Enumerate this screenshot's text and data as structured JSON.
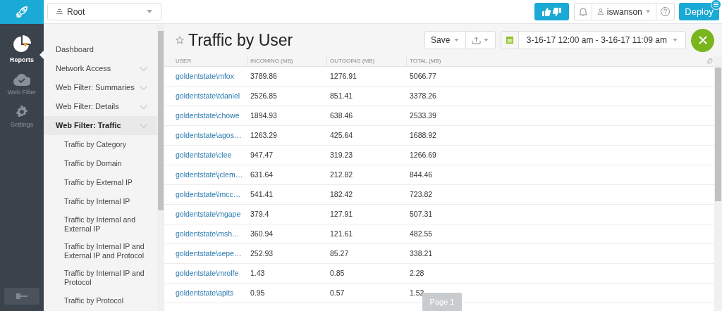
{
  "app_rail": {
    "items": [
      {
        "label": "Reports",
        "kind": "reports",
        "selected": true
      },
      {
        "label": "Web Filter",
        "kind": "webfilter",
        "selected": false
      },
      {
        "label": "Settings",
        "kind": "settings",
        "selected": false
      }
    ]
  },
  "scope_selector": {
    "value": "Root"
  },
  "top_bar": {
    "user": "iswanson",
    "deploy_button": "Deploy"
  },
  "nav": {
    "items": [
      {
        "label": "Dashboard",
        "kind": "link",
        "selected": false
      },
      {
        "label": "Network Access",
        "kind": "group",
        "selected": false
      },
      {
        "label": "Web Filter: Summaries",
        "kind": "group",
        "selected": false
      },
      {
        "label": "Web Filter: Details",
        "kind": "group",
        "selected": false
      },
      {
        "label": "Web Filter: Traffic",
        "kind": "group",
        "selected": true,
        "children": [
          {
            "label": "Traffic by Category"
          },
          {
            "label": "Traffic by Domain"
          },
          {
            "label": "Traffic by External IP"
          },
          {
            "label": "Traffic by Internal IP"
          },
          {
            "label": "Traffic by Internal and External IP"
          },
          {
            "label": "Traffic by Internal IP and External IP and Protocol"
          },
          {
            "label": "Traffic by Internal IP and Protocol"
          },
          {
            "label": "Traffic by Protocol"
          }
        ]
      }
    ]
  },
  "report": {
    "title": "Traffic by User",
    "starred": false,
    "save_button": "Save",
    "date_range": "3-16-17 12:00 am - 3-16-17 11:09 am"
  },
  "table": {
    "columns": [
      "USER",
      "INCOMING (MB)",
      "OUTGOING (MB)",
      "TOTAL (MB)"
    ],
    "rows": [
      [
        "goldentstate\\mfox",
        "3789.86",
        "1276.91",
        "5066.77"
      ],
      [
        "goldentstate\\tdaniel",
        "2526.85",
        "851.41",
        "3378.26"
      ],
      [
        "goldentstate\\chowe",
        "1894.93",
        "638.46",
        "2533.39"
      ],
      [
        "goldentstate\\agos…",
        "1263.29",
        "425.64",
        "1688.92"
      ],
      [
        "goldentstate\\clee",
        "947.47",
        "319.23",
        "1266.69"
      ],
      [
        "goldentstate\\jclem…",
        "631.64",
        "212.82",
        "844.46"
      ],
      [
        "goldentstate\\lmcc…",
        "541.41",
        "182.42",
        "723.82"
      ],
      [
        "goldentstate\\mgape",
        "379.4",
        "127.91",
        "507.31"
      ],
      [
        "goldentstate\\msh…",
        "360.94",
        "121.61",
        "482.55"
      ],
      [
        "goldentstate\\sepe…",
        "252.93",
        "85.27",
        "338.21"
      ],
      [
        "goldentstate\\mrolfe",
        "1.43",
        "0.85",
        "2.28"
      ],
      [
        "goldentstate\\apits",
        "0.95",
        "0.57",
        "1.52"
      ]
    ]
  },
  "pager": {
    "label": "Page 1"
  }
}
